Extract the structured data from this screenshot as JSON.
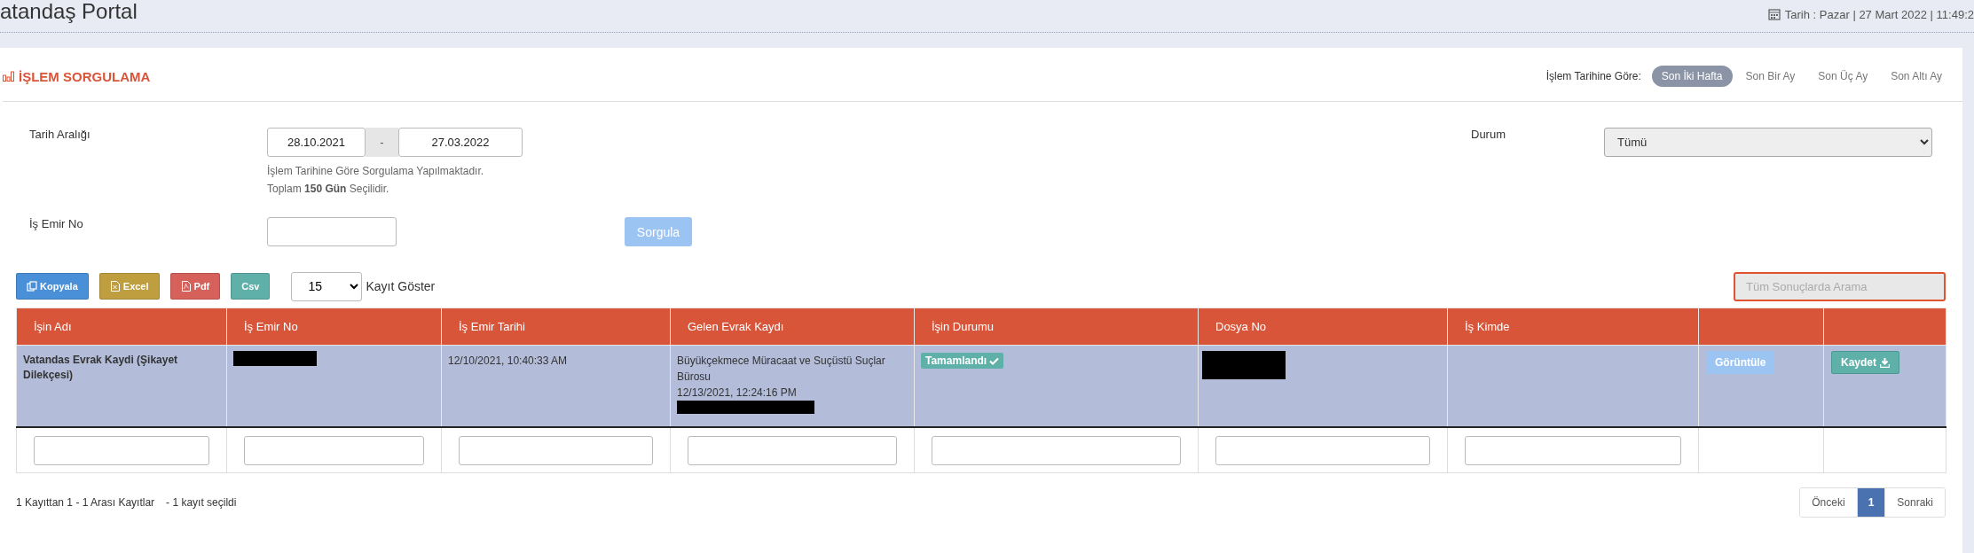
{
  "header": {
    "title": "atandaş Portal",
    "datetime": "Tarih : Pazar | 27 Mart 2022 | 11:49:2"
  },
  "panel": {
    "title": "İŞLEM SORGULAMA",
    "range_label": "İşlem Tarihine Göre:",
    "range_options": [
      {
        "label": "Son İki Hafta",
        "selected": true
      },
      {
        "label": "Son Bir Ay",
        "selected": false
      },
      {
        "label": "Son Üç Ay",
        "selected": false
      },
      {
        "label": "Son Altı Ay",
        "selected": false
      }
    ]
  },
  "form": {
    "date_range": {
      "label": "Tarih Aralığı",
      "start": "28.10.2021",
      "separator": "-",
      "end": "27.03.2022",
      "hint": "İşlem Tarihine Göre Sorgulama Yapılmaktadır.",
      "total": "Toplam **150 Gün** Seçilidir."
    },
    "status": {
      "label": "Durum",
      "value": "Tümü"
    },
    "order_no": {
      "label": "İş Emir No"
    },
    "submit": {
      "label": "Sorgula",
      "disabled": true
    }
  },
  "toolbar": {
    "export_buttons": [
      {
        "label": "Kopyala",
        "kind": "copy"
      },
      {
        "label": "Excel",
        "kind": "excel"
      },
      {
        "label": "Pdf",
        "kind": "pdf"
      },
      {
        "label": "Csv",
        "kind": "csv"
      }
    ],
    "page_size": "15",
    "page_size_label": "Kayıt Göster",
    "search": {
      "placeholder": "Tüm Sonuçlarda Arama"
    }
  },
  "table": {
    "columns": [
      {
        "label": "İşin Adı",
        "filter": true
      },
      {
        "label": "İş Emir No",
        "filter": true
      },
      {
        "label": "İş Emir Tarihi",
        "filter": true
      },
      {
        "label": "Gelen Evrak Kaydı",
        "filter": true
      },
      {
        "label": "İşin Durumu",
        "filter": true
      },
      {
        "label": "Dosya No",
        "filter": true
      },
      {
        "label": "İş Kimde",
        "filter": true
      },
      {
        "filter": false
      },
      {
        "filter": false
      }
    ],
    "rows": [
      {
        "selected": true,
        "cells": [
          {
            "kind": "title",
            "text": "Vatandas Evrak Kaydi (Şikayet Dilekçesi)"
          },
          {
            "kind": "redacted"
          },
          {
            "kind": "text",
            "lines": [
              "12/10/2021, 10:40:33 AM"
            ]
          },
          {
            "kind": "text",
            "lines": [
              "Büyükçekmece Müracaat ve Suçüstü Suçlar Bürosu",
              "12/13/2021, 12:24:16 PM"
            ],
            "redacted": true
          },
          {
            "kind": "badge",
            "text": "Tamamlandı"
          },
          {
            "kind": "redacted"
          },
          {
            "kind": "empty"
          },
          {
            "kind": "view",
            "text": "Görüntüle"
          },
          {
            "kind": "save",
            "text": "Kaydet"
          }
        ]
      }
    ]
  },
  "footer": {
    "info": "1 Kayıttan 1 - 1 Arası Kayıtlar",
    "selection": "- 1 kayıt seçildi",
    "pagination": [
      {
        "label": "Önceki",
        "selected": false
      },
      {
        "label": "1",
        "selected": true
      },
      {
        "label": "Sonraki",
        "selected": false
      }
    ]
  }
}
